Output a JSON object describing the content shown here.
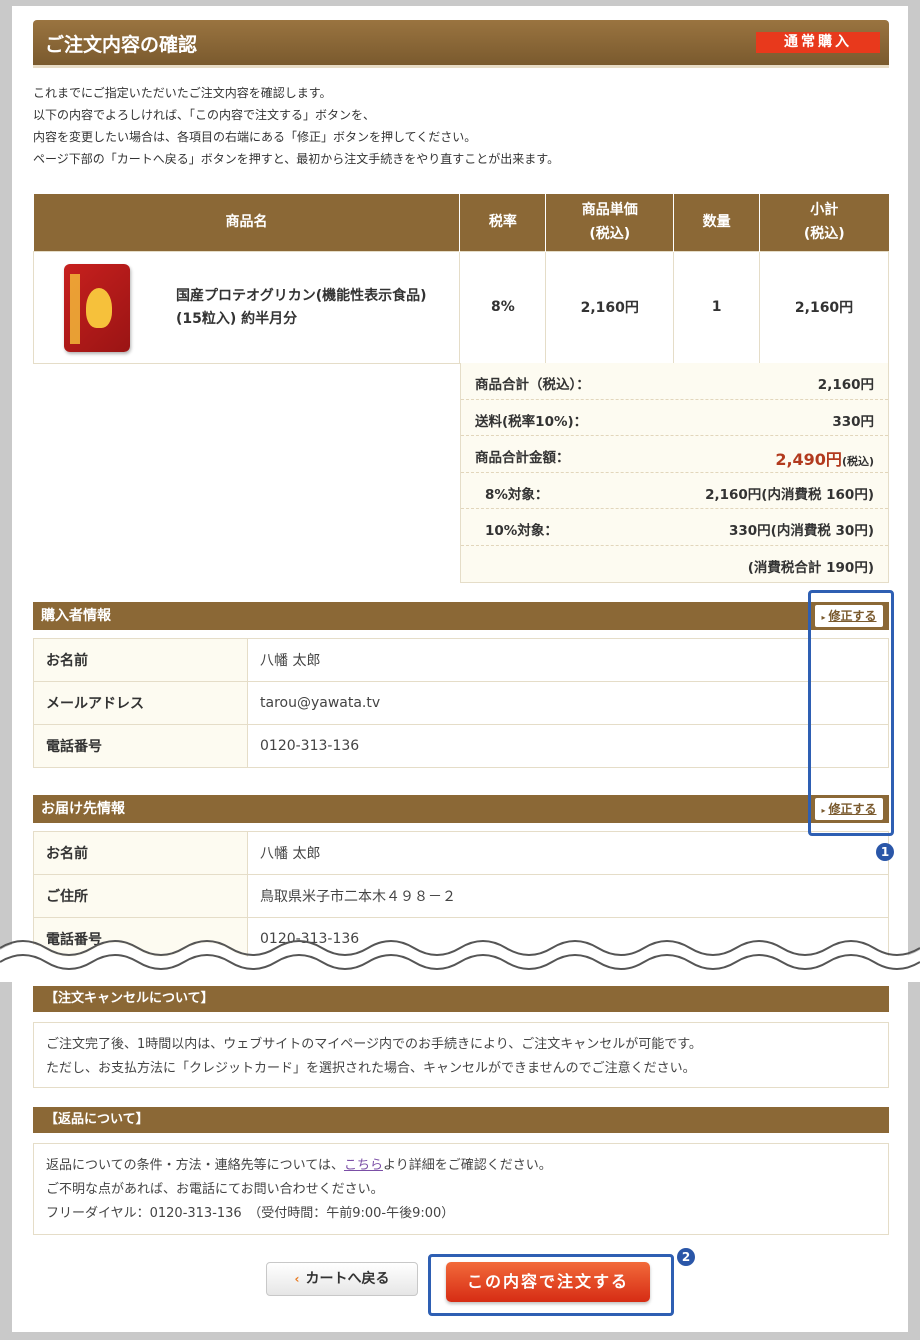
{
  "header": {
    "title": "ご注文内容の確認",
    "badge": "通常購入"
  },
  "intro": [
    "これまでにご指定いただいたご注文内容を確認します。",
    "以下の内容でよろしければ、「この内容で注文する」ボタンを、",
    "内容を変更したい場合は、各項目の右端にある「修正」ボタンを押してください。",
    "ページ下部の「カートへ戻る」ボタンを押すと、最初から注文手続きをやり直すことが出来ます。"
  ],
  "order_table": {
    "headers": {
      "product": "商品名",
      "tax_rate": "税率",
      "unit_price": "商品単価",
      "unit_price_sub": "(税込)",
      "qty": "数量",
      "subtotal": "小計",
      "subtotal_sub": "(税込)"
    },
    "row": {
      "name_line1": "国産プロテオグリカン(機能性表示食品)",
      "name_line2": "(15粒入) 約半月分",
      "tax_rate": "8%",
      "unit_price": "2,160円",
      "qty": "1",
      "subtotal": "2,160円"
    }
  },
  "summary": [
    {
      "label": "商品合計（税込）：",
      "value": "2,160円"
    },
    {
      "label": "送料(税率10%)：",
      "value": "330円"
    },
    {
      "label": "商品合計金額：",
      "value": "2,490円",
      "unit": "(税込)"
    },
    {
      "label": "8%対象：",
      "value": "2,160円(内消費税 160円)"
    },
    {
      "label": "10%対象：",
      "value": "330円(内消費税 30円)"
    },
    {
      "label": "",
      "value": "(消費税合計 190円)"
    }
  ],
  "buyer": {
    "title": "購入者情報",
    "edit": "修正する",
    "rows": [
      {
        "k": "お名前",
        "v": "八幡 太郎"
      },
      {
        "k": "メールアドレス",
        "v": "tarou@yawata.tv"
      },
      {
        "k": "電話番号",
        "v": "0120-313-136"
      }
    ]
  },
  "delivery": {
    "title": "お届け先情報",
    "edit": "修正する",
    "rows": [
      {
        "k": "お名前",
        "v": "八幡 太郎"
      },
      {
        "k": "ご住所",
        "v": "鳥取県米子市二本木４９８－２"
      },
      {
        "k": "電話番号",
        "v": "0120-313-136"
      }
    ]
  },
  "cancel": {
    "title": "【注文キャンセルについて】",
    "line1": "ご注文完了後、1時間以内は、ウェブサイトのマイページ内でのお手続きにより、ご注文キャンセルが可能です。",
    "line2": "ただし、お支払方法に「クレジットカード」を選択された場合、キャンセルができませんのでご注意ください。"
  },
  "returns": {
    "title": "【返品について】",
    "line1_pre": "返品についての条件・方法・連絡先等については、",
    "line1_link": "こちら",
    "line1_post": "より詳細をご確認ください。",
    "line2": "ご不明な点があれば、お電話にてお問い合わせください。",
    "line3": "フリーダイヤル：0120-313-136　（受付時間：午前9:00-午後9:00）"
  },
  "buttons": {
    "back": "カートへ戻る",
    "submit": "この内容で注文する"
  },
  "markers": {
    "m1": "1",
    "m2": "2"
  },
  "colors": {
    "brand_brown": "#8b6836",
    "accent_red": "#e8391c",
    "highlight_blue": "#2e5fb3"
  }
}
